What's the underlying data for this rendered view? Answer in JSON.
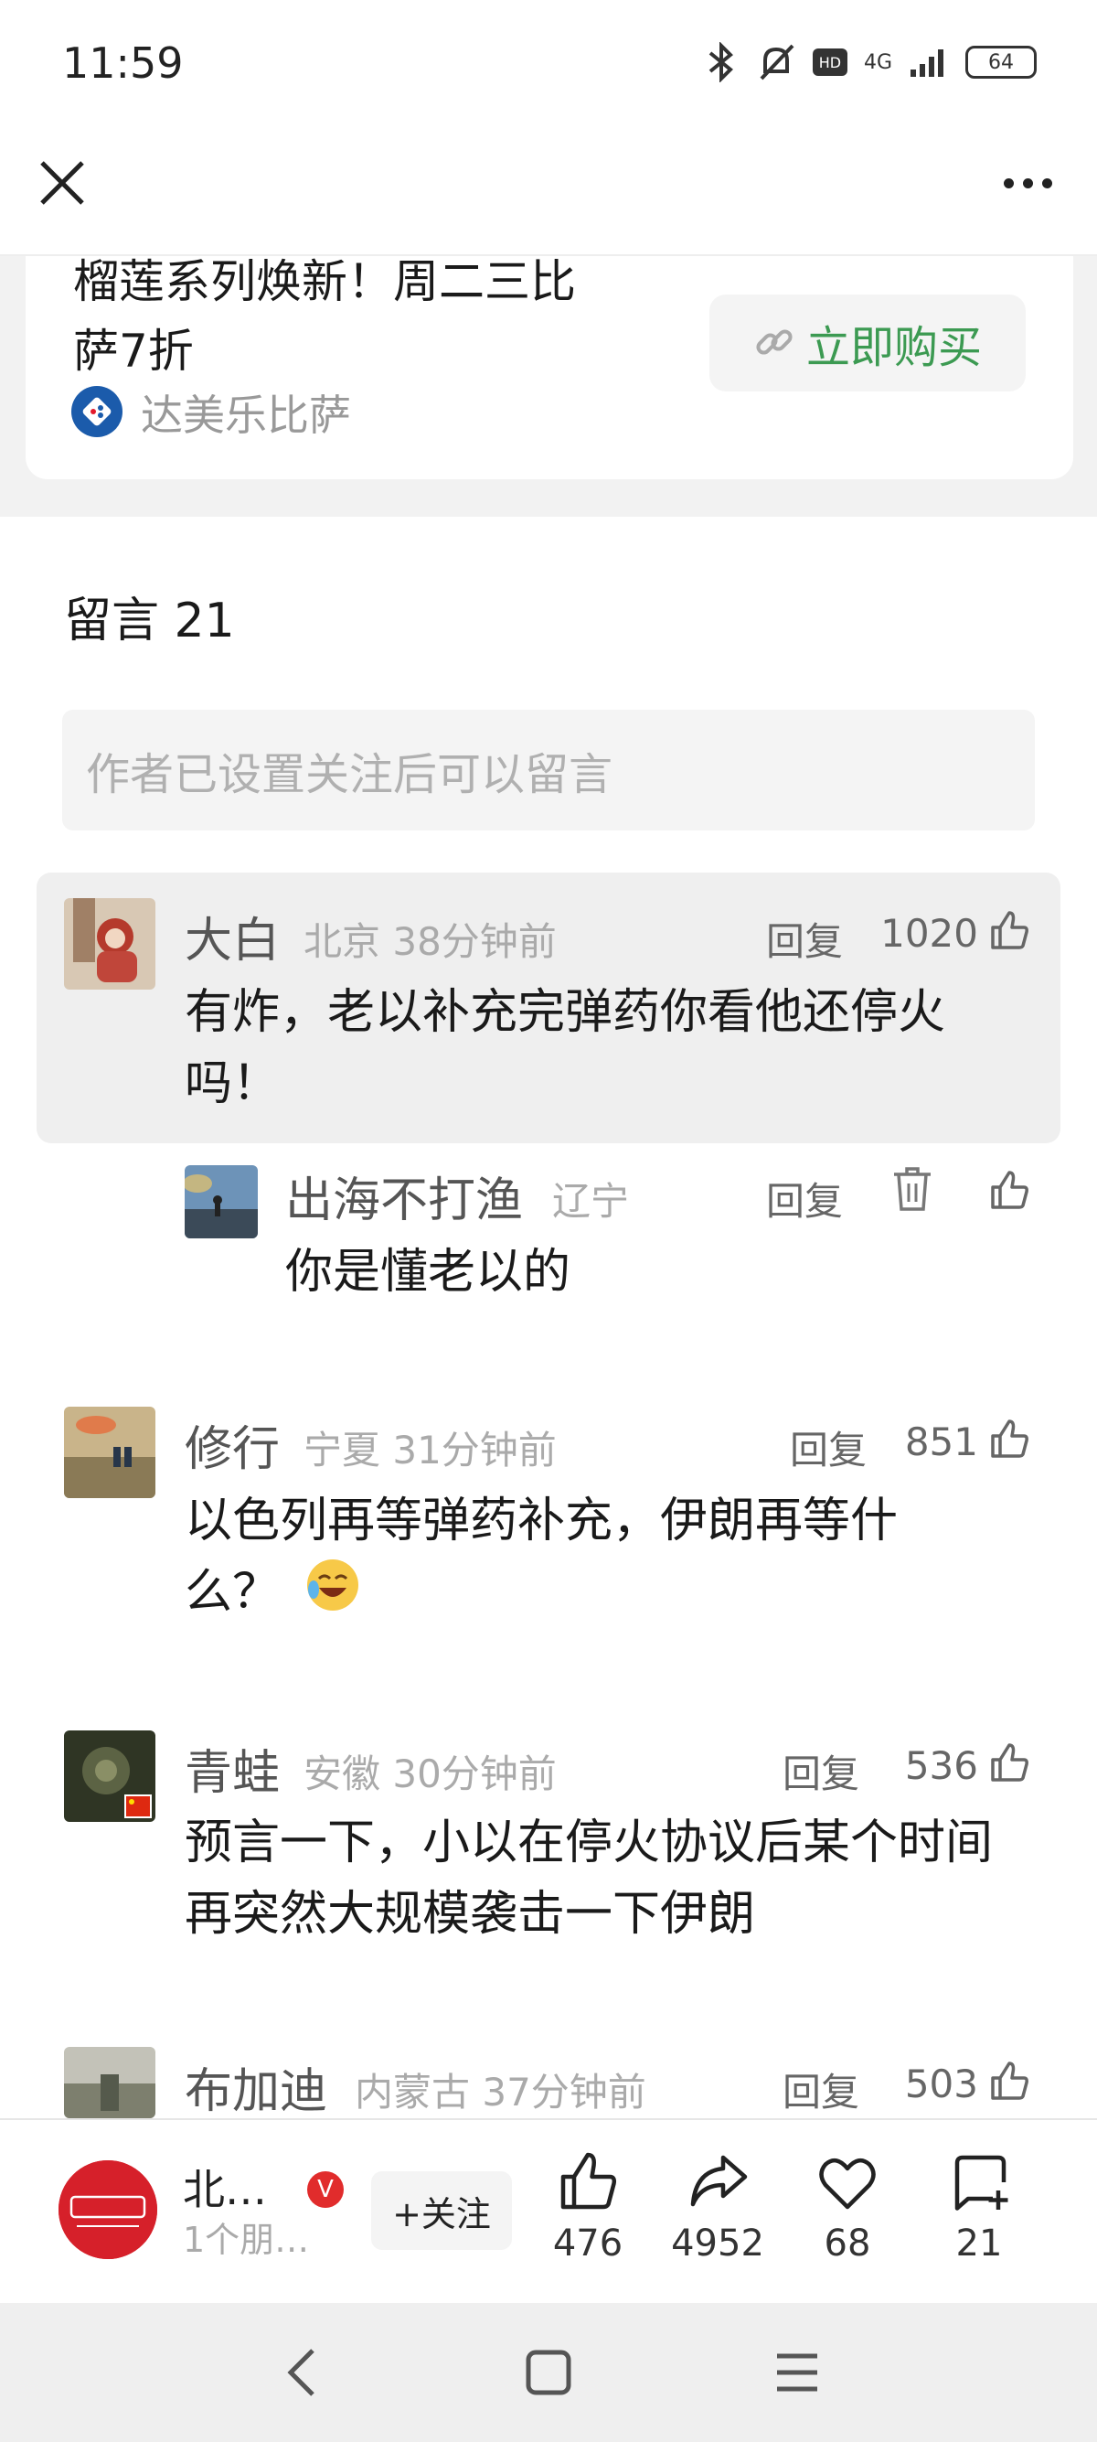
{
  "status_bar": {
    "time": "11:59",
    "battery": "64",
    "network": "4G"
  },
  "ad": {
    "title": "榴莲系列焕新！周二三比萨7折",
    "title_line1": "榴莲系列焕新！周二三比",
    "title_line2": "萨7折",
    "brand": "达美乐比萨",
    "buy_label": "立即购买"
  },
  "comments_header": {
    "title": "留言 21",
    "input_placeholder": "作者已设置关注后可以留言"
  },
  "comments": [
    {
      "name": "大白",
      "meta": "北京 38分钟前",
      "reply": "回复",
      "likes": "1020",
      "text": "有炸，老以补充完弹药你看他还停火吗！"
    },
    {
      "name": "出海不打渔",
      "meta": "辽宁",
      "reply": "回复",
      "text": "你是懂老以的"
    },
    {
      "name": "修行",
      "meta": "宁夏 31分钟前",
      "reply": "回复",
      "likes": "851",
      "text": "以色列再等弹药补充，伊朗再等什么？"
    },
    {
      "name": "青蛙",
      "meta": "安徽 30分钟前",
      "reply": "回复",
      "likes": "536",
      "text": "预言一下，小以在停火协议后某个时间再突然大规模袭击一下伊朗"
    },
    {
      "name": "布加迪",
      "meta": "内蒙古 37分钟前",
      "reply": "回复",
      "likes": "503"
    }
  ],
  "bottom_bar": {
    "publisher_name": "北…",
    "publisher_sub": "1个朋…",
    "follow_label": "+关注",
    "like_count": "476",
    "share_count": "4952",
    "fav_count": "68",
    "comment_count": "21"
  },
  "colors": {
    "accent_green": "#3c9a52",
    "brand_red": "#d6202a"
  }
}
